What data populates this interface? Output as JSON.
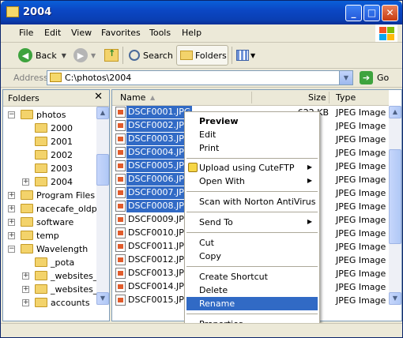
{
  "window": {
    "title": "2004",
    "controls": {
      "minimize": "_",
      "maximize": "□",
      "close": "✕"
    }
  },
  "menu": [
    "File",
    "Edit",
    "View",
    "Favorites",
    "Tools",
    "Help"
  ],
  "toolbar": {
    "back_label": "Back",
    "search_label": "Search",
    "folders_label": "Folders"
  },
  "address": {
    "label": "Address",
    "value": "C:\\photos\\2004",
    "go_label": "Go"
  },
  "folders_pane": {
    "title": "Folders",
    "close": "✕",
    "tree": [
      {
        "label": "photos",
        "expanded": true,
        "level": 0
      },
      {
        "label": "2000",
        "level": 1
      },
      {
        "label": "2001",
        "level": 1
      },
      {
        "label": "2002",
        "level": 1
      },
      {
        "label": "2003",
        "level": 1
      },
      {
        "label": "2004",
        "level": 1,
        "expandable": true,
        "selected": true
      },
      {
        "label": "Program Files",
        "level": 0,
        "expandable": true
      },
      {
        "label": "racecafe_oldpc",
        "level": 0,
        "expandable": true
      },
      {
        "label": "software",
        "level": 0,
        "expandable": true
      },
      {
        "label": "temp",
        "level": 0,
        "expandable": true
      },
      {
        "label": "Wavelength",
        "level": 0,
        "expanded": true
      },
      {
        "label": "_pota",
        "level": 1
      },
      {
        "label": "_websites_",
        "level": 1,
        "expandable": true
      },
      {
        "label": "_websites_",
        "level": 1,
        "expandable": true
      },
      {
        "label": "accounts",
        "level": 1,
        "expandable": true
      }
    ]
  },
  "files": {
    "columns": {
      "name": "Name",
      "size": "Size",
      "type": "Type"
    },
    "rows": [
      {
        "name": "DSCF0001.JPG",
        "size": "622 KB",
        "type": "JPEG Image",
        "selected": true
      },
      {
        "name": "DSCF0002.JPG",
        "size": "",
        "type": "JPEG Image",
        "selected": true
      },
      {
        "name": "DSCF0003.JPG",
        "size": "",
        "type": "JPEG Image",
        "selected": true
      },
      {
        "name": "DSCF0004.JPG",
        "size": "",
        "type": "JPEG Image",
        "selected": true
      },
      {
        "name": "DSCF0005.JPG",
        "size": "",
        "type": "JPEG Image",
        "selected": true
      },
      {
        "name": "DSCF0006.JPG",
        "size": "",
        "type": "JPEG Image",
        "selected": true
      },
      {
        "name": "DSCF0007.JPG",
        "size": "",
        "type": "JPEG Image",
        "selected": true
      },
      {
        "name": "DSCF0008.JPG",
        "size": "",
        "type": "JPEG Image",
        "selected": true
      },
      {
        "name": "DSCF0009.JPG",
        "size": "",
        "type": "JPEG Image",
        "selected": false
      },
      {
        "name": "DSCF0010.JPG",
        "size": "",
        "type": "JPEG Image",
        "selected": false
      },
      {
        "name": "DSCF0011.JPG",
        "size": "",
        "type": "JPEG Image",
        "selected": false
      },
      {
        "name": "DSCF0012.JPG",
        "size": "",
        "type": "JPEG Image",
        "selected": false
      },
      {
        "name": "DSCF0013.JPG",
        "size": "",
        "type": "JPEG Image",
        "selected": false
      },
      {
        "name": "DSCF0014.JPG",
        "size": "",
        "type": "JPEG Image",
        "selected": false
      },
      {
        "name": "DSCF0015.JPG",
        "size": "",
        "type": "JPEG Image",
        "selected": false
      }
    ]
  },
  "context_menu": {
    "preview": "Preview",
    "edit": "Edit",
    "print": "Print",
    "upload": "Upload using CuteFTP",
    "open_with": "Open With",
    "scan": "Scan with Norton AntiVirus",
    "send_to": "Send To",
    "cut": "Cut",
    "copy": "Copy",
    "create_shortcut": "Create Shortcut",
    "delete": "Delete",
    "rename": "Rename",
    "properties": "Properties"
  },
  "colors": {
    "selection": "#316ac5",
    "titlebar": "#0b47c4"
  }
}
